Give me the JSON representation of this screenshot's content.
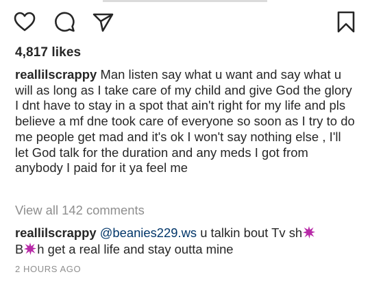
{
  "post": {
    "likes_text": "4,817 likes",
    "caption_username": "reallilscrappy",
    "caption_text": "Man listen say what u want and say what u will as long as I take care of my child and give God the glory I dnt have to stay in a spot that ain't right for my life and pls believe a mf dne took care of everyone so soon as I try to do me people get mad and it's ok I won't say nothing else , I'll let God talk for the duration and any meds I got from anybody I paid for it ya feel me",
    "view_all_comments": "View all 142 comments",
    "comment": {
      "username": "reallilscrappy",
      "mention": "@beanies229.ws",
      "text_part1": "u talkin bout Tv sh",
      "text_part2": "B",
      "text_part3": "h get a real life and stay outta mine"
    },
    "timestamp": "2 HOURS AGO"
  },
  "icons": {
    "like": "heart-icon",
    "comment": "speech-bubble-icon",
    "share": "paper-plane-icon",
    "save": "bookmark-icon",
    "censor": "censor-splat-icon"
  },
  "colors": {
    "text": "#262626",
    "secondary": "#8e8e8e",
    "mention": "#003569",
    "censor": "#b82aa8"
  }
}
